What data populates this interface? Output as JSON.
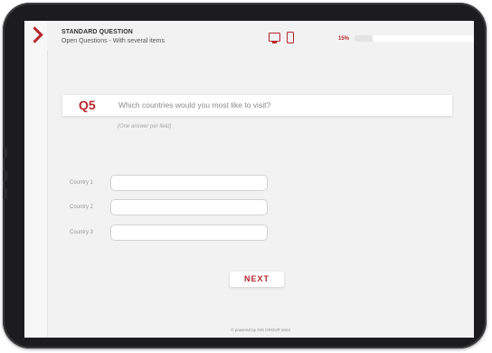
{
  "header": {
    "title": "STANDARD QUESTION",
    "subtitle": "Open Questions - With several items",
    "device_icons": [
      "desktop-icon",
      "phone-icon"
    ],
    "progress_label": "15%",
    "progress_value": 0.15
  },
  "question": {
    "number": "Q5",
    "text": "Which countries would you most like to visit?",
    "hint": "(One answer per field)"
  },
  "fields": [
    {
      "label": "Country 1",
      "value": ""
    },
    {
      "label": "Country 2",
      "value": ""
    },
    {
      "label": "Country 3",
      "value": ""
    }
  ],
  "next_button": "NEXT",
  "footer": "© powered by NIS GROUP 2023",
  "colors": {
    "accent": "#b5272d",
    "background": "#f2f2f2",
    "device_frame": "#1c1c1e"
  }
}
